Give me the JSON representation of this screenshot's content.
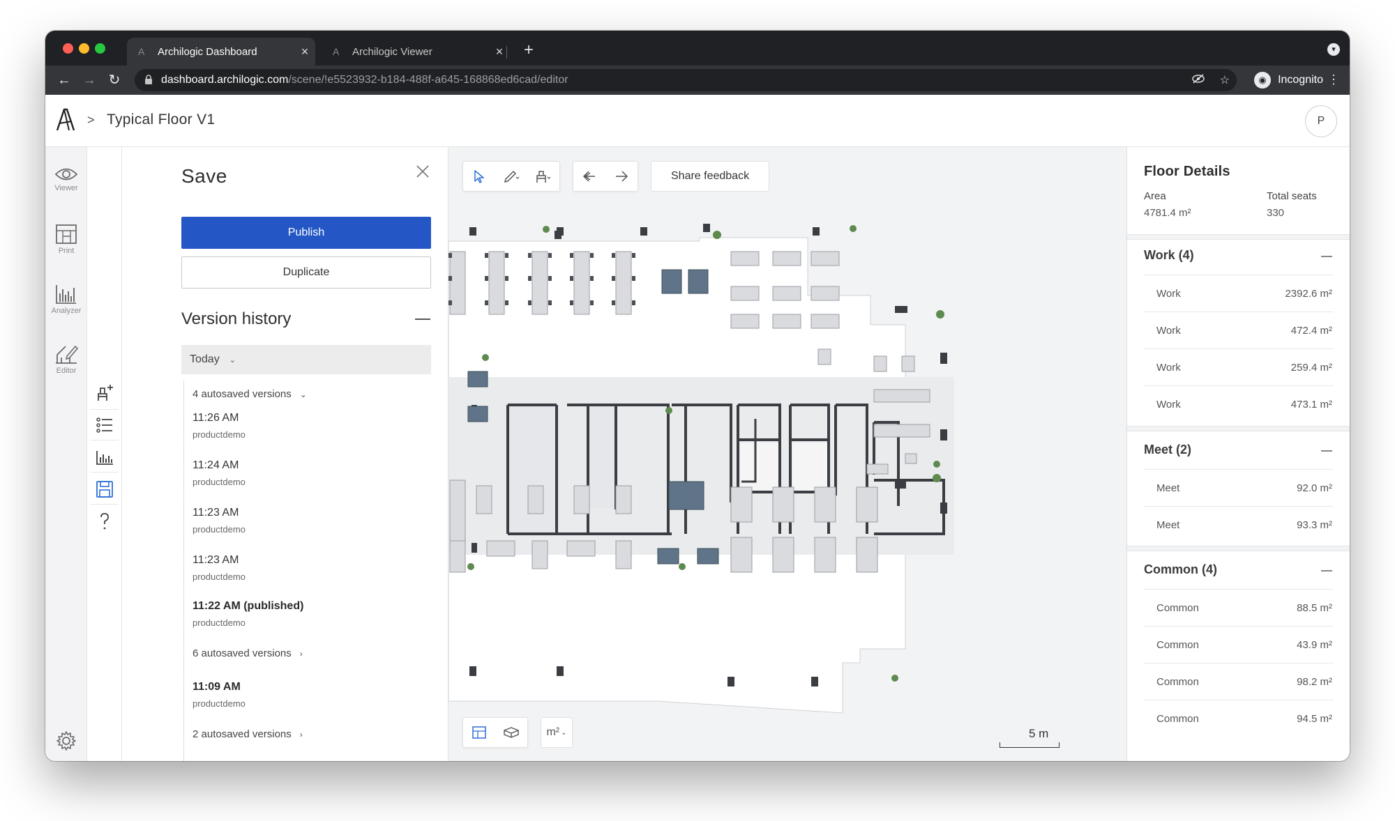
{
  "browser": {
    "tabs": [
      {
        "title": "Archilogic Dashboard",
        "active": true
      },
      {
        "title": "Archilogic Viewer",
        "active": false
      }
    ],
    "url_host": "dashboard.archilogic.com",
    "url_path": "/scene/!e5523932-b184-488f-a645-168868ed6cad/editor",
    "profile_label": "Incognito"
  },
  "header": {
    "breadcrumb_separator": ">",
    "title": "Typical Floor V1",
    "avatar_initial": "P"
  },
  "rail": {
    "items": [
      {
        "label": "Viewer",
        "icon": "eye-icon"
      },
      {
        "label": "Print",
        "icon": "print-icon"
      },
      {
        "label": "Analyzer",
        "icon": "chart-icon"
      },
      {
        "label": "Editor",
        "icon": "editor-icon"
      }
    ]
  },
  "save_panel": {
    "title": "Save",
    "publish_label": "Publish",
    "duplicate_label": "Duplicate",
    "version_history_title": "Version history",
    "today_label": "Today",
    "entries": [
      {
        "type": "group",
        "label": "4 autosaved versions",
        "expanded": true
      },
      {
        "type": "version",
        "time": "11:26 AM",
        "user": "productdemo"
      },
      {
        "type": "version",
        "time": "11:24 AM",
        "user": "productdemo"
      },
      {
        "type": "version",
        "time": "11:23 AM",
        "user": "productdemo"
      },
      {
        "type": "version",
        "time": "11:23 AM",
        "user": "productdemo"
      },
      {
        "type": "version",
        "time": "11:22 AM (published)",
        "user": "productdemo",
        "bold": true
      },
      {
        "type": "group",
        "label": "6 autosaved versions",
        "expanded": false
      },
      {
        "type": "version",
        "time": "11:09 AM",
        "user": "productdemo",
        "bold": true
      },
      {
        "type": "group",
        "label": "2 autosaved versions",
        "expanded": false
      }
    ]
  },
  "canvas": {
    "feedback_label": "Share feedback",
    "unit_label": "m²",
    "scale_label": "5 m"
  },
  "floor_details": {
    "title": "Floor Details",
    "area_label": "Area",
    "area_value": "4781.4 m²",
    "seats_label": "Total seats",
    "seats_value": "330",
    "groups": [
      {
        "title": "Work (4)",
        "rows": [
          {
            "name": "Work",
            "area": "2392.6 m²"
          },
          {
            "name": "Work",
            "area": "472.4 m²"
          },
          {
            "name": "Work",
            "area": "259.4 m²"
          },
          {
            "name": "Work",
            "area": "473.1 m²"
          }
        ]
      },
      {
        "title": "Meet (2)",
        "rows": [
          {
            "name": "Meet",
            "area": "92.0 m²"
          },
          {
            "name": "Meet",
            "area": "93.3 m²"
          }
        ]
      },
      {
        "title": "Common (4)",
        "rows": [
          {
            "name": "Common",
            "area": "88.5 m²"
          },
          {
            "name": "Common",
            "area": "43.9 m²"
          },
          {
            "name": "Common",
            "area": "98.2 m²"
          },
          {
            "name": "Common",
            "area": "94.5 m²"
          }
        ]
      }
    ]
  },
  "colors": {
    "accent": "#2457c5",
    "active_icon": "#2d6fd6",
    "browser_frame": "#202124",
    "canvas_bg": "#f2f3f5",
    "wall": "#3a3d42",
    "meeting_table": "#5f7488",
    "plant": "#5e8a4e"
  }
}
